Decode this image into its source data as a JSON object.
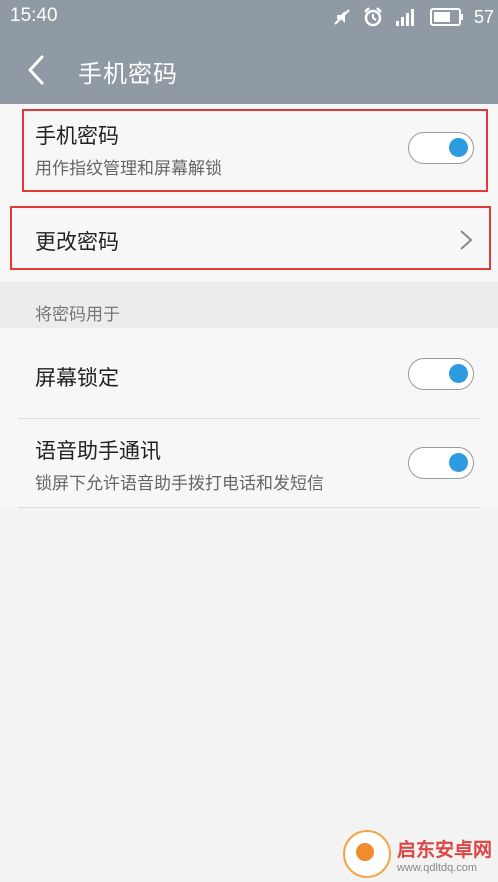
{
  "status_bar": {
    "time": "15:40",
    "battery": "57",
    "icons": [
      "mute-icon",
      "alarm-icon",
      "signal-icon",
      "battery-icon"
    ]
  },
  "app_bar": {
    "title": "手机密码",
    "back_icon": "chevron-left-icon"
  },
  "settings": {
    "phone_password": {
      "title": "手机密码",
      "subtitle": "用作指纹管理和屏幕解锁",
      "enabled": true
    },
    "change_password": {
      "title": "更改密码",
      "icon": "chevron-right-icon"
    },
    "section_header": "将密码用于",
    "screen_lock": {
      "title": "屏幕锁定",
      "enabled": true
    },
    "voice_assistant": {
      "title": "语音助手通讯",
      "subtitle": "锁屏下允许语音助手拨打电话和发短信",
      "enabled": true
    }
  },
  "colors": {
    "header_bg": "#8f9aa4",
    "toggle_on": "#2d9be0",
    "highlight": "#e23a3a"
  },
  "watermark": {
    "name": "启东安卓网",
    "url": "www.qdltdq.com"
  }
}
